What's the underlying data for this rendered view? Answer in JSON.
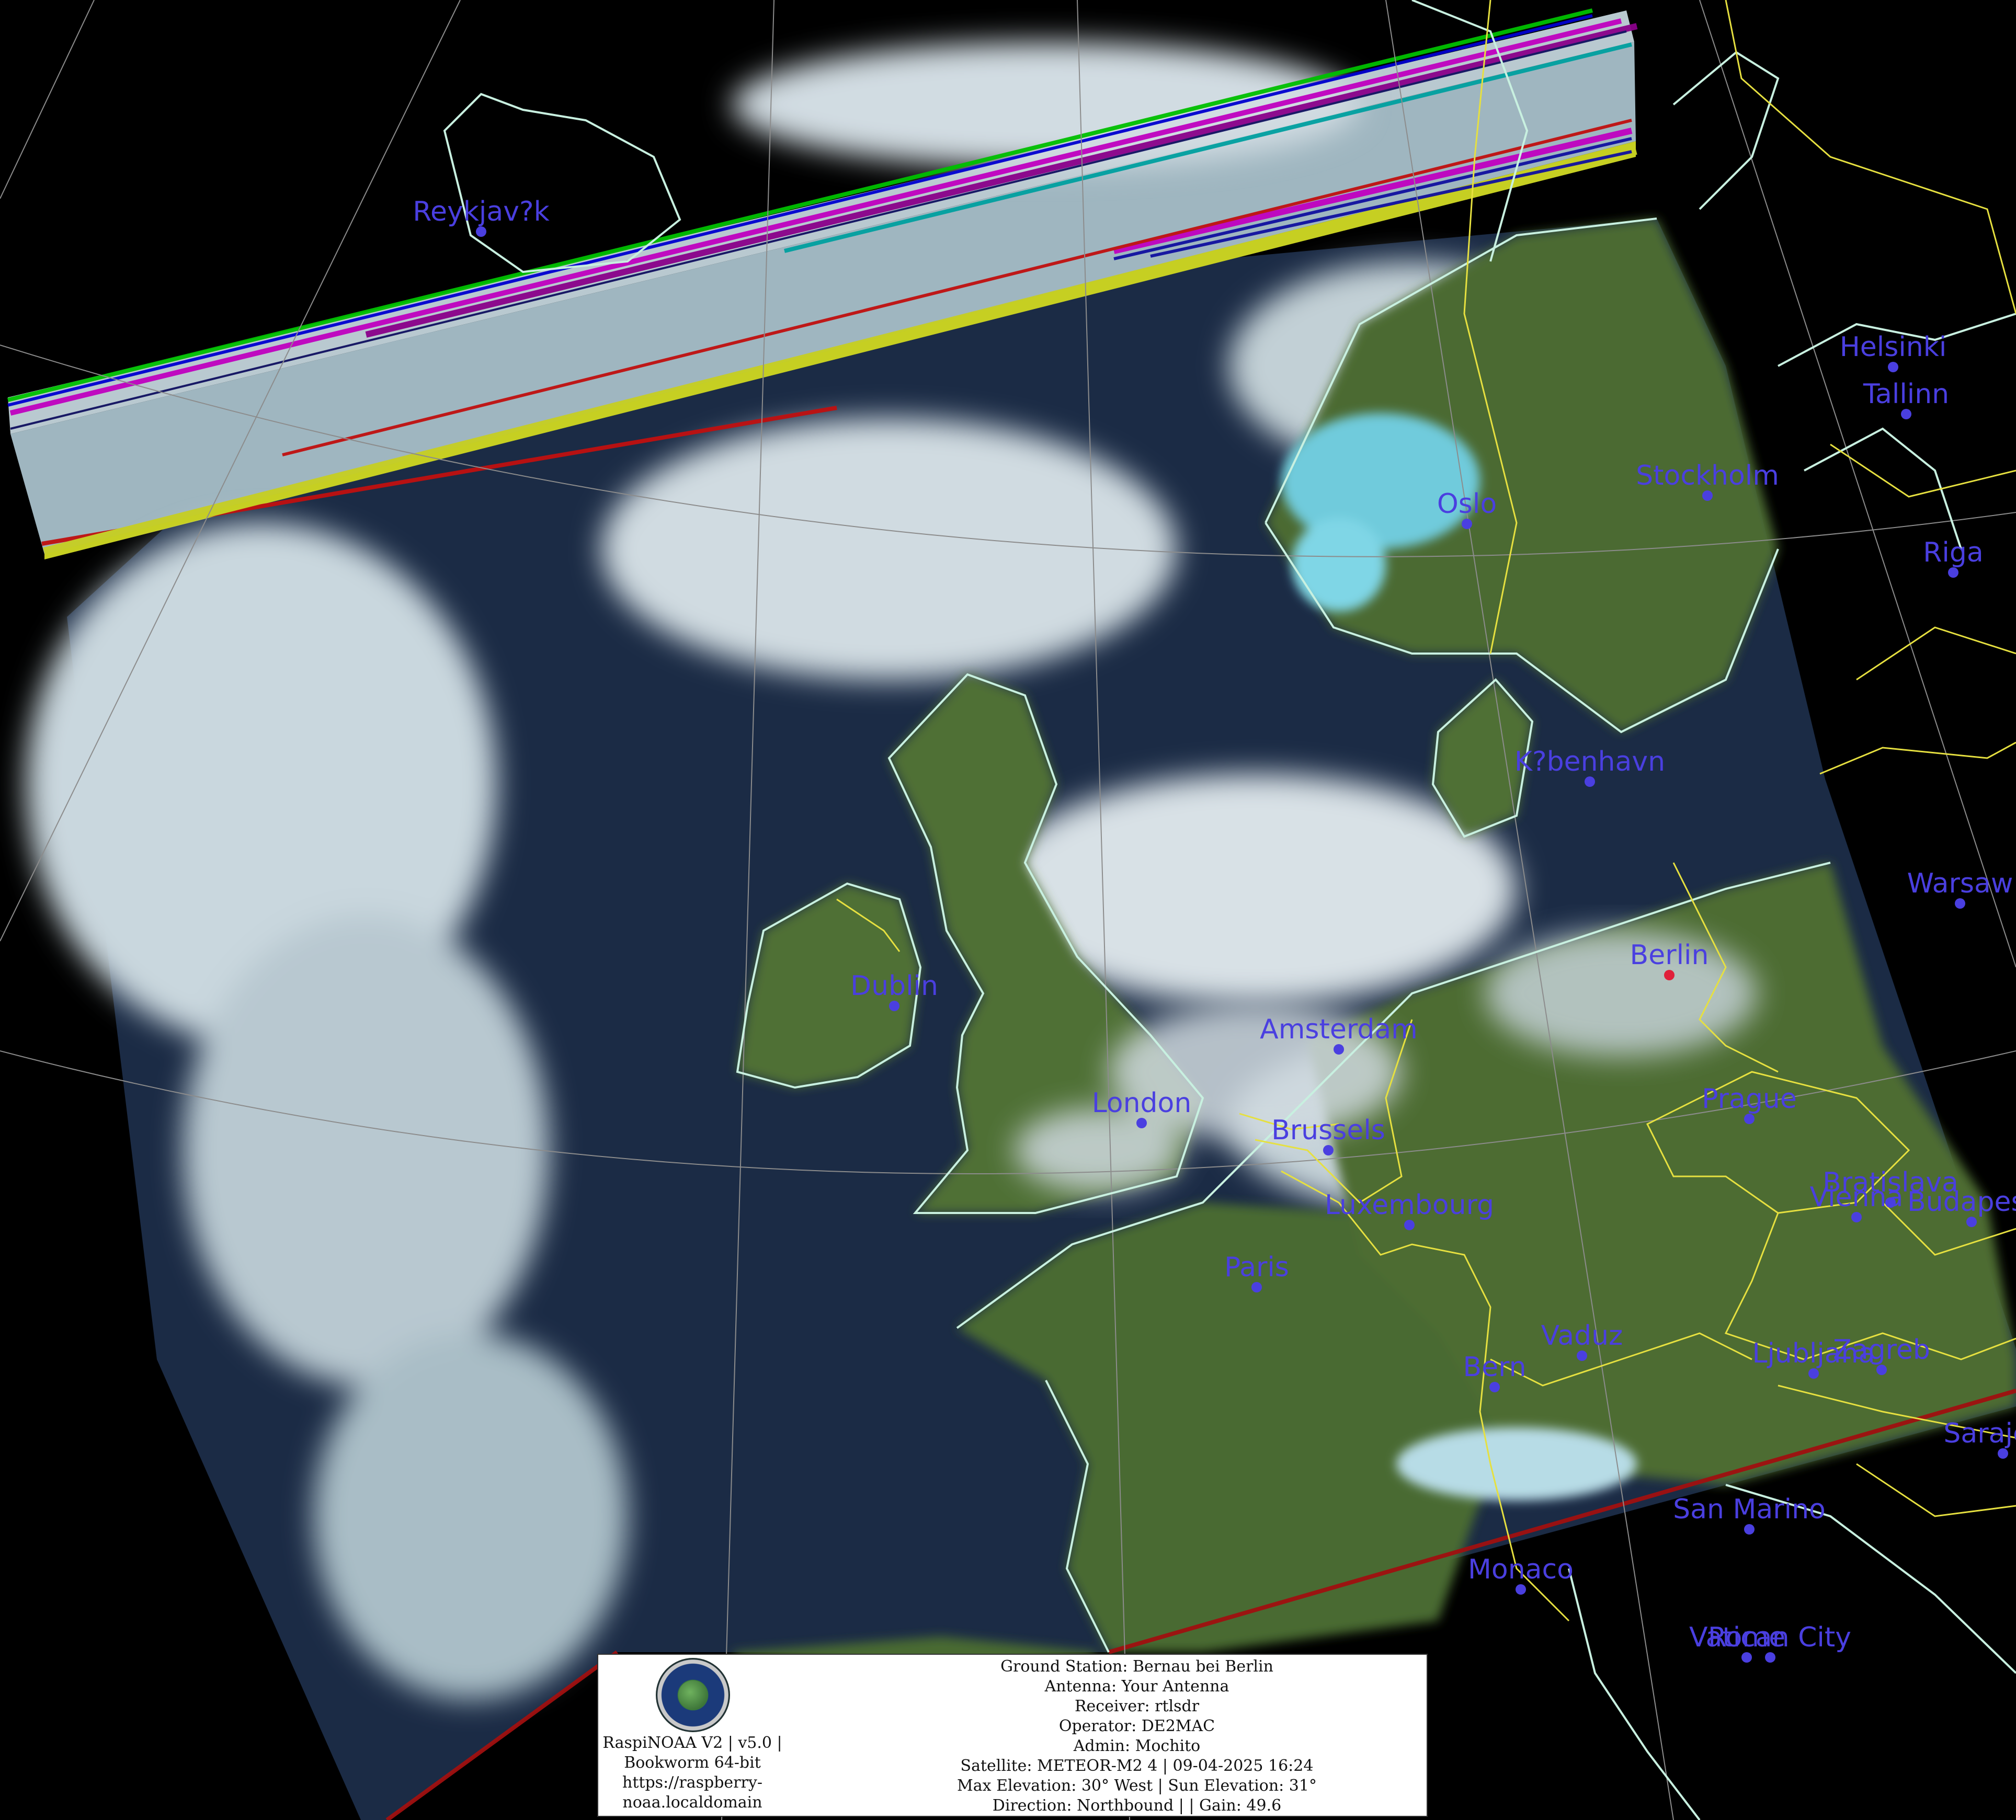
{
  "cities": [
    {
      "name": "Reykjav?k",
      "id": "reykjavik"
    },
    {
      "name": "Helsinki",
      "id": "helsinki"
    },
    {
      "name": "Tallinn",
      "id": "tallinn"
    },
    {
      "name": "Oslo",
      "id": "oslo"
    },
    {
      "name": "Stockholm",
      "id": "stockholm"
    },
    {
      "name": "Riga",
      "id": "riga"
    },
    {
      "name": "K?benhavn",
      "id": "kobenhavn"
    },
    {
      "name": "Warsaw",
      "id": "warsaw"
    },
    {
      "name": "Berlin",
      "id": "berlin"
    },
    {
      "name": "Dublin",
      "id": "dublin"
    },
    {
      "name": "Amsterdam",
      "id": "amsterdam"
    },
    {
      "name": "London",
      "id": "london"
    },
    {
      "name": "Brussels",
      "id": "brussels"
    },
    {
      "name": "Prague",
      "id": "prague"
    },
    {
      "name": "Luxembourg",
      "id": "luxembourg"
    },
    {
      "name": "Vienna",
      "id": "vienna"
    },
    {
      "name": "Bratislava",
      "id": "bratislava"
    },
    {
      "name": "Budapest",
      "id": "budapest"
    },
    {
      "name": "Paris",
      "id": "paris"
    },
    {
      "name": "Vaduz",
      "id": "vaduz"
    },
    {
      "name": "Bern",
      "id": "bern"
    },
    {
      "name": "Ljubljana",
      "id": "ljubljana"
    },
    {
      "name": "Zagreb",
      "id": "zagreb"
    },
    {
      "name": "Sarajevo",
      "id": "sarajevo"
    },
    {
      "name": "San Marino",
      "id": "san-marino"
    },
    {
      "name": "Monaco",
      "id": "monaco"
    },
    {
      "name": "Vatican City",
      "id": "vatican"
    },
    {
      "name": "Rome",
      "id": "rome"
    }
  ],
  "info": {
    "left_lines": [
      "RaspiNOAA V2 | v5.0 |",
      "Bookworm 64-bit",
      "https://raspberry-",
      "noaa.localdomain"
    ],
    "right_lines": [
      "Ground Station: Bernau bei Berlin",
      "Antenna: Your Antenna",
      "Receiver: rtlsdr",
      "Operator: DE2MAC",
      "Admin: Mochito",
      "Satellite: METEOR-M2 4 | 09-04-2025 16:24",
      "Max Elevation: 30° West | Sun Elevation: 31°",
      "Direction: Northbound | | Gain: 49.6"
    ]
  },
  "colors": {
    "city_label": "#4a3fe0",
    "capital_marker": "#e0203a",
    "coastline": "#c8f0e0",
    "border": "#e6e040",
    "graticule": "#8c8c8c",
    "ocean": "#1a2a44",
    "land": "#4a6a32",
    "cloud": "#d9e3ea",
    "snow": "#7fd6e6"
  }
}
